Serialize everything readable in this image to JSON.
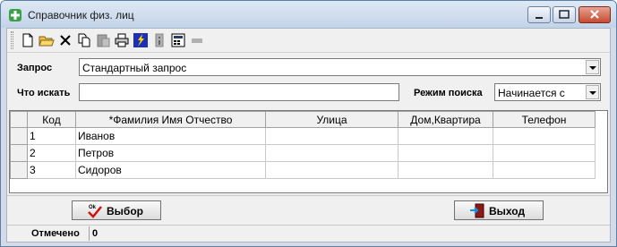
{
  "window": {
    "title": "Справочник физ. лиц"
  },
  "form": {
    "query_label": "Запрос",
    "query_value": "Стандартный запрос",
    "search_label": "Что искать",
    "search_value": "",
    "mode_label": "Режим поиска",
    "mode_value": "Начинается с"
  },
  "table": {
    "headers": [
      "Код",
      "*Фамилия Имя Отчество",
      "Улица",
      "Дом,Квартира",
      "Телефон"
    ],
    "rows": [
      [
        "1",
        "Иванов",
        "",
        "",
        ""
      ],
      [
        "2",
        "Петров",
        "",
        "",
        ""
      ],
      [
        "3",
        "Сидоров",
        "",
        "",
        ""
      ]
    ]
  },
  "buttons": {
    "select_label": "Выбор",
    "exit_label": "Выход"
  },
  "status": {
    "marked_label": "Отмечено",
    "marked_count": "0"
  },
  "toolbar_icons": [
    "new-document-icon",
    "open-folder-icon",
    "delete-icon",
    "copy-icon",
    "paste-icon",
    "print-icon",
    "run-query-icon",
    "info-icon",
    "calculator-icon",
    "minus-icon"
  ],
  "colors": {
    "window_border": "#5a7fa8",
    "close_button": "#c44a2f"
  }
}
